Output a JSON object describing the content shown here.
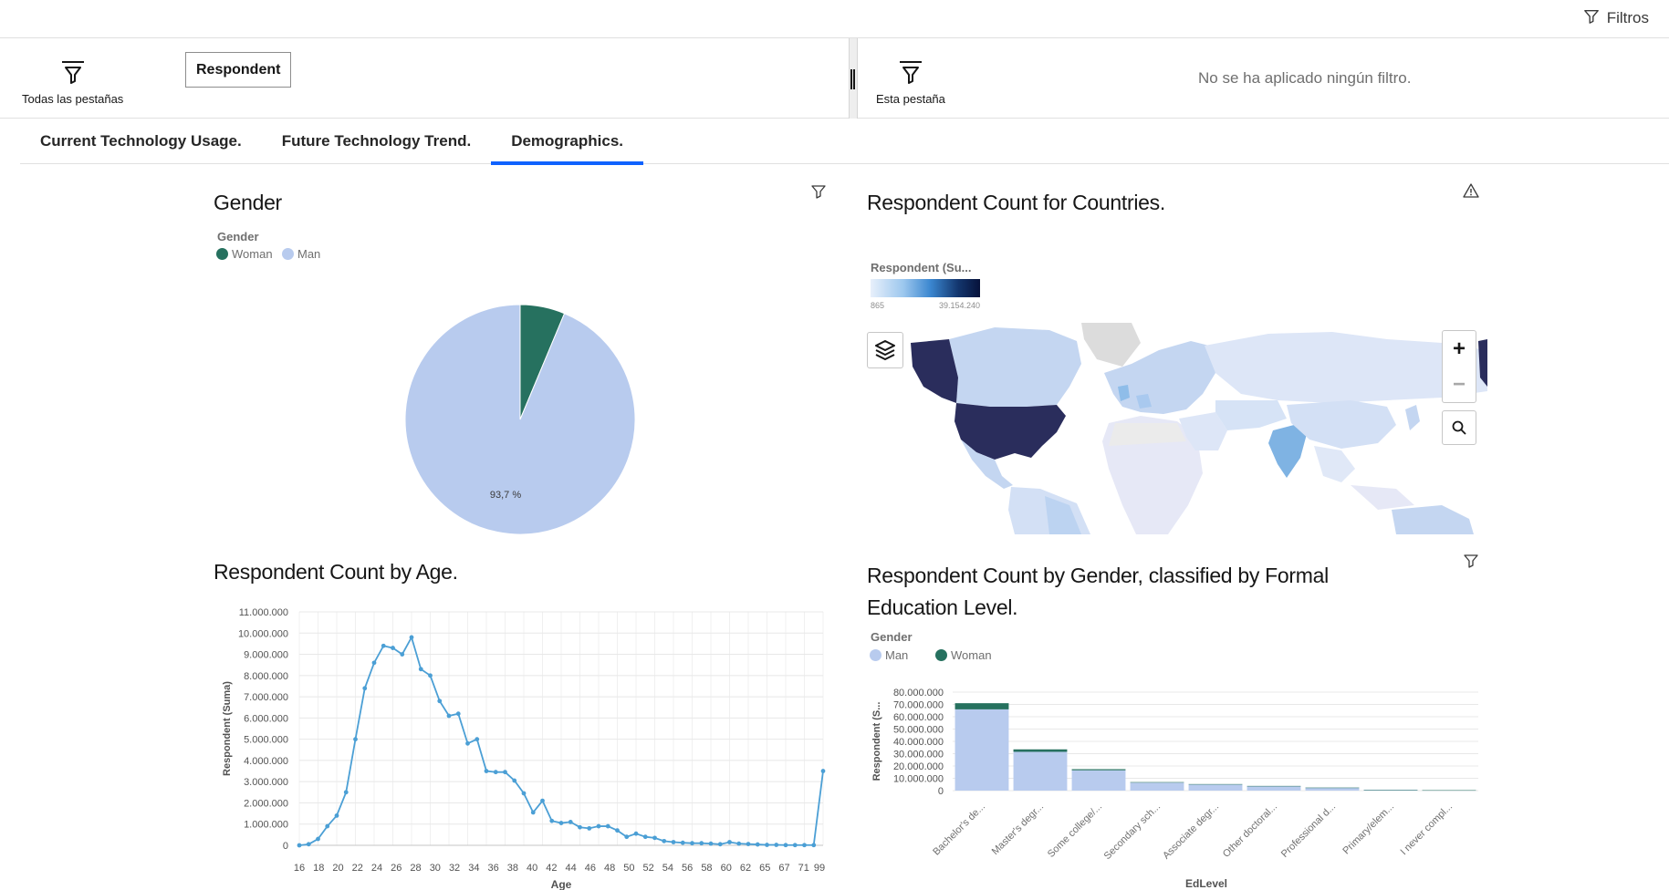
{
  "toolbar": {
    "filters_label": "Filtros"
  },
  "filter_panel": {
    "all_tabs_label": "Todas las pestañas",
    "chip_label": "Respondent",
    "this_tab_label": "Esta pestaña",
    "no_filter_text": "No se ha aplicado ningún filtro."
  },
  "tabs": [
    {
      "label": "Current Technology Usage."
    },
    {
      "label": "Future Technology Trend."
    },
    {
      "label": "Demographics."
    }
  ],
  "active_tab": 2,
  "gender_widget": {
    "title": "Gender",
    "legend_title": "Gender",
    "legend": [
      {
        "label": "Woman",
        "color": "#26715f"
      },
      {
        "label": "Man",
        "color": "#b8cbee"
      }
    ],
    "chart_data": {
      "type": "pie",
      "slices": [
        {
          "label": "Woman",
          "value": 6.3
        },
        {
          "label": "Man",
          "value": 93.7
        }
      ],
      "data_label": "93,7 %"
    }
  },
  "country_widget": {
    "title": "Respondent Count for Countries.",
    "legend_title": "Respondent (Su...",
    "scale_min": "865",
    "scale_max": "39.154.240",
    "zoom_in": "+",
    "zoom_out": "−"
  },
  "age_widget": {
    "title": "Respondent Count by Age.",
    "chart_data": {
      "type": "line",
      "xlabel": "Age",
      "ylabel": "Respondent (Suma)",
      "ylim": [
        0,
        11000000
      ],
      "yticks": [
        "0",
        "1.000.000",
        "2.000.000",
        "3.000.000",
        "4.000.000",
        "5.000.000",
        "6.000.000",
        "7.000.000",
        "8.000.000",
        "9.000.000",
        "10.000.000",
        "11.000.000"
      ],
      "xtick_labels": [
        "16",
        "18",
        "20",
        "22",
        "24",
        "26",
        "28",
        "30",
        "32",
        "34",
        "36",
        "38",
        "40",
        "42",
        "44",
        "46",
        "48",
        "50",
        "52",
        "54",
        "56",
        "58",
        "60",
        "62",
        "65",
        "67",
        "71",
        "99"
      ],
      "values": [
        0,
        50000,
        300000,
        900000,
        1400000,
        2500000,
        5000000,
        7400000,
        8600000,
        9400000,
        9300000,
        9000000,
        9800000,
        8300000,
        8000000,
        6800000,
        6100000,
        6200000,
        4800000,
        5000000,
        3500000,
        3450000,
        3450000,
        3050000,
        2450000,
        1550000,
        2100000,
        1150000,
        1050000,
        1100000,
        850000,
        800000,
        900000,
        900000,
        700000,
        400000,
        550000,
        400000,
        350000,
        200000,
        150000,
        120000,
        100000,
        100000,
        80000,
        50000,
        150000,
        80000,
        60000,
        40000,
        20000,
        20000,
        10000,
        10000,
        10000,
        10000,
        3500000
      ]
    }
  },
  "edu_widget": {
    "title": "Respondent Count by Gender, classified by Formal Education Level.",
    "legend_title": "Gender",
    "legend": [
      {
        "label": "Man",
        "color": "#b8cbee"
      },
      {
        "label": "Woman",
        "color": "#26715f"
      }
    ],
    "chart_data": {
      "type": "bar",
      "stacked": true,
      "xlabel": "EdLevel",
      "ylabel": "Respondent (S...",
      "ylim": [
        0,
        80000000
      ],
      "yticks": [
        "0",
        "10.000.000",
        "20.000.000",
        "30.000.000",
        "40.000.000",
        "50.000.000",
        "60.000.000",
        "70.000.000",
        "80.000.000"
      ],
      "categories": [
        "Bachelor's de...",
        "Master's degr...",
        "Some college/...",
        "Secondary sch...",
        "Associate degr...",
        "Other doctoral...",
        "Professional d...",
        "Primary/elem...",
        "I never compl..."
      ],
      "series": [
        {
          "name": "Man",
          "values": [
            66000000,
            31500000,
            16500000,
            6500000,
            5000000,
            3600000,
            2300000,
            600000,
            300000
          ]
        },
        {
          "name": "Woman",
          "values": [
            5000000,
            2000000,
            900000,
            400000,
            300000,
            200000,
            150000,
            50000,
            30000
          ]
        }
      ]
    }
  }
}
